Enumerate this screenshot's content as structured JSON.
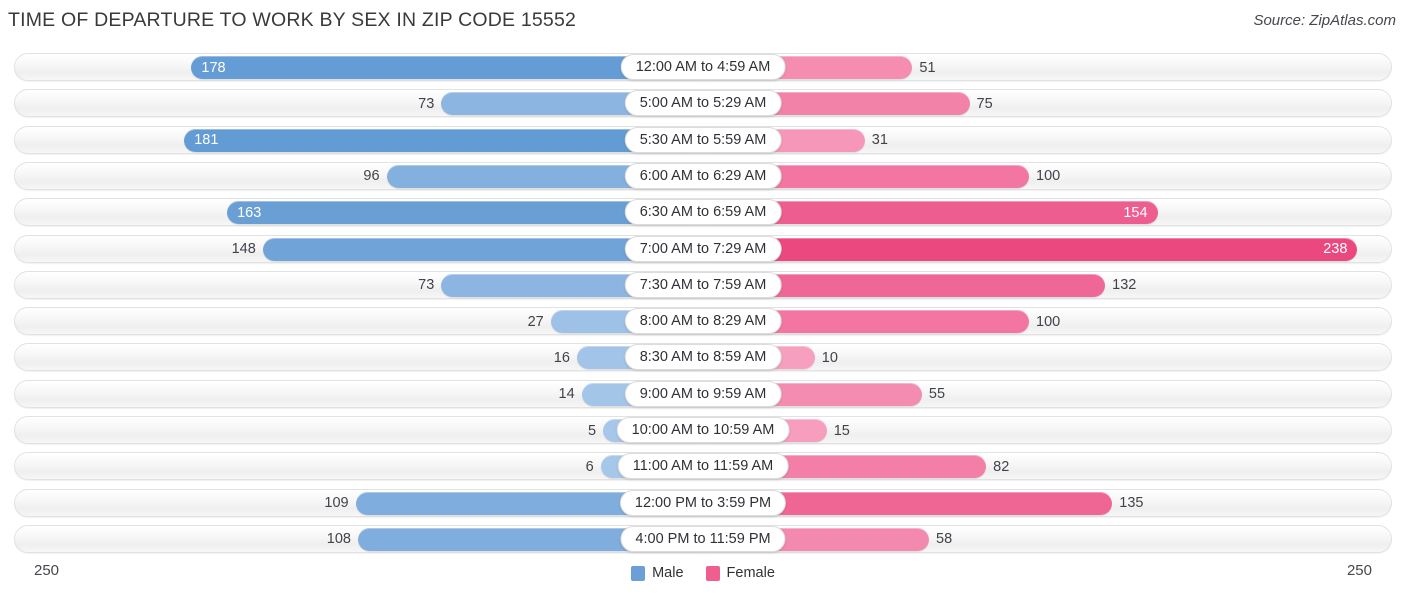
{
  "header": {
    "title": "TIME OF DEPARTURE TO WORK BY SEX IN ZIP CODE 15552",
    "source": "Source: ZipAtlas.com"
  },
  "axis": {
    "left_max": "250",
    "right_max": "250"
  },
  "legend": {
    "items": [
      {
        "label": "Male",
        "color": "#6b9fd8"
      },
      {
        "label": "Female",
        "color": "#ee5f90"
      }
    ]
  },
  "chart_data": {
    "type": "bar",
    "title": "TIME OF DEPARTURE TO WORK BY SEX IN ZIP CODE 15552",
    "subtitle": "Source: ZipAtlas.com",
    "orientation": "horizontal-diverging",
    "xlabel": "",
    "ylabel": "",
    "xlim": [
      250,
      250
    ],
    "grid": false,
    "legend_position": "bottom-center",
    "categories": [
      "12:00 AM to 4:59 AM",
      "5:00 AM to 5:29 AM",
      "5:30 AM to 5:59 AM",
      "6:00 AM to 6:29 AM",
      "6:30 AM to 6:59 AM",
      "7:00 AM to 7:29 AM",
      "7:30 AM to 7:59 AM",
      "8:00 AM to 8:29 AM",
      "8:30 AM to 8:59 AM",
      "9:00 AM to 9:59 AM",
      "10:00 AM to 10:59 AM",
      "11:00 AM to 11:59 AM",
      "12:00 PM to 3:59 PM",
      "4:00 PM to 11:59 PM"
    ],
    "series": [
      {
        "name": "Male",
        "color": "#6b9fd8",
        "side": "left",
        "values": [
          178,
          73,
          181,
          96,
          163,
          148,
          73,
          27,
          16,
          14,
          5,
          6,
          109,
          108
        ]
      },
      {
        "name": "Female",
        "color": "#ee5f90",
        "side": "right",
        "values": [
          51,
          75,
          31,
          100,
          154,
          238,
          132,
          100,
          10,
          55,
          15,
          82,
          135,
          58
        ]
      }
    ]
  }
}
